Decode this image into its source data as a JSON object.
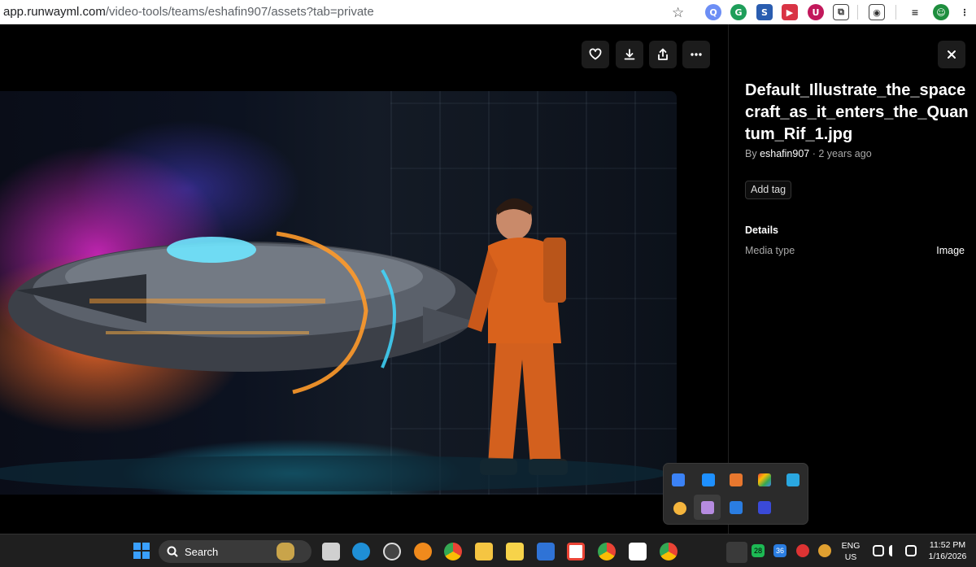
{
  "browser": {
    "url_host": "app.runwayml.com",
    "url_path": "/video-tools/teams/eshafin907/assets?tab=private"
  },
  "viewer": {
    "actions": [
      "heart-icon",
      "download-icon",
      "share-icon",
      "more-icon"
    ]
  },
  "side": {
    "title": "Default_Illustrate_the_spacecraft_as_it_enters_the_Quantum_Rif_1.jpg",
    "by_prefix": "By ",
    "author": "eshafin907",
    "time": " · 2 years ago",
    "add_tag": "Add tag",
    "details_heading": "Details",
    "media_type_label": "Media type",
    "media_type_value": "Image"
  },
  "taskbar": {
    "search_label": "Search",
    "lang_line1": "ENG",
    "lang_line2": "US",
    "time": "11:52 PM",
    "date": "1/16/2026",
    "badge_a": "28",
    "badge_b": "36"
  },
  "colors": {
    "background": "#000000",
    "button_bg": "#1c1c1c",
    "muted_text": "#a8a8a8"
  }
}
